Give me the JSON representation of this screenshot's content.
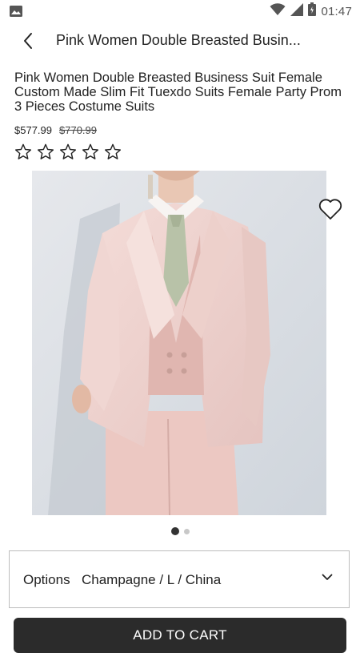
{
  "status_bar": {
    "time": "01:47"
  },
  "header": {
    "title": "Pink Women Double Breasted Busin..."
  },
  "product": {
    "title": "Pink Women Double Breasted Business Suit Female Custom Made Slim Fit Tuexdo Suits Female Party Prom 3 Pieces Costume Suits",
    "price": "$577.99",
    "original_price": "$770.99",
    "rating": 0,
    "rating_max": 5,
    "image_count": 2,
    "active_image": 1
  },
  "options": {
    "label": "Options",
    "value": "Champagne / L / China"
  },
  "cart": {
    "label": "ADD TO CART"
  },
  "colors": {
    "accent": "#2b2b2b",
    "text": "#222222",
    "border": "#bdbdbd"
  }
}
